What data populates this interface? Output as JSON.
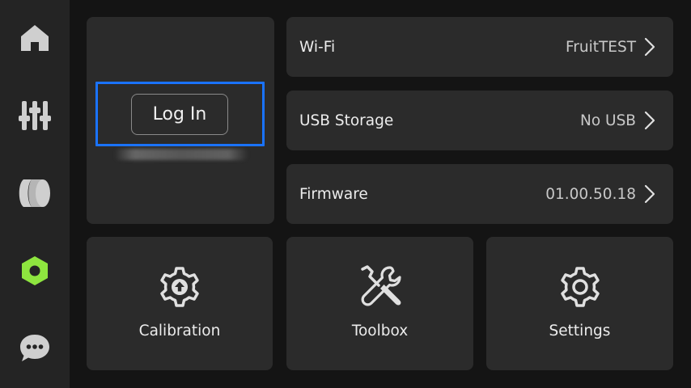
{
  "sidebar": {
    "items": [
      {
        "icon": "home-icon",
        "active": false
      },
      {
        "icon": "controls-icon",
        "active": false
      },
      {
        "icon": "filament-spool-icon",
        "active": false
      },
      {
        "icon": "settings-hex-icon",
        "active": true
      },
      {
        "icon": "chat-icon",
        "active": false
      }
    ],
    "active_color": "#8ee53f",
    "inactive_color": "#cfcfcf"
  },
  "account": {
    "login_label": "Log In",
    "focus_color": "#1a73ff"
  },
  "rows": {
    "wifi": {
      "label": "Wi-Fi",
      "value": "FruitTEST"
    },
    "usb": {
      "label": "USB Storage",
      "value": "No USB"
    },
    "firmware": {
      "label": "Firmware",
      "value": "01.00.50.18"
    }
  },
  "tiles": {
    "calibration": {
      "label": "Calibration",
      "icon": "calibration-gear-icon"
    },
    "toolbox": {
      "label": "Toolbox",
      "icon": "tools-icon"
    },
    "settings": {
      "label": "Settings",
      "icon": "gear-icon"
    }
  }
}
